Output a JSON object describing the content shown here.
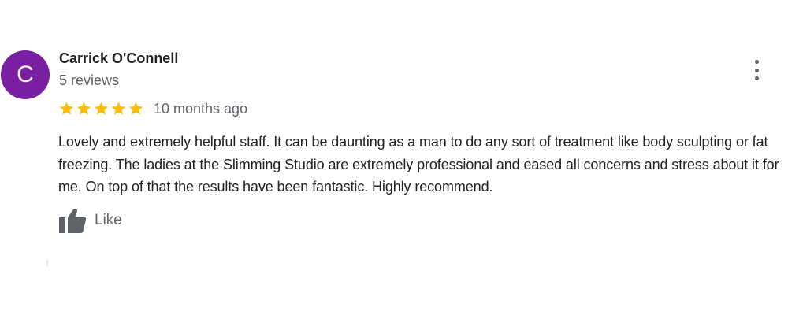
{
  "review": {
    "avatar_letter": "C",
    "avatar_color": "#7b1fa2",
    "author_name": "Carrick O'Connell",
    "review_count_text": "5 reviews",
    "rating": 5,
    "rating_max": 5,
    "star_color": "#fbbc04",
    "time_ago": "10 months ago",
    "text": "Lovely and extremely helpful staff. It can be daunting as a man to do any sort of treatment like body sculpting or fat freezing. The ladies at the Slimming Studio are extremely professional and eased all concerns and stress about it for me. On top of that the results have been fantastic. Highly recommend.",
    "like_label": "Like",
    "icons": {
      "more": "more-vert-icon",
      "like": "thumbs-up-icon",
      "star": "star-icon"
    }
  }
}
